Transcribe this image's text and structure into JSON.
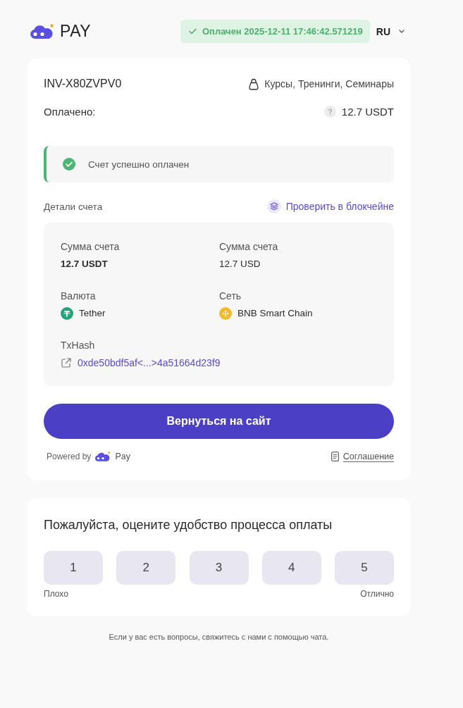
{
  "header": {
    "logo_text": "PAY",
    "status": {
      "paid": true,
      "label": "Оплачен 2025-12-11 17:46:42.571219"
    },
    "language": "RU"
  },
  "invoice": {
    "id": "INV-X80ZVPV0",
    "category": "Курсы, Тренинги, Семинары",
    "paid_label": "Оплачено:",
    "paid_amount": "12.7 USDT",
    "alert": {
      "kind": "success",
      "text": "Счет успешно оплачен"
    },
    "details_title": "Детали счета",
    "verify_link": "Проверить в блокчейне",
    "details": [
      {
        "kind": "amount",
        "label": "Сумма счета",
        "value": "12.7 USDT",
        "strong": true
      },
      {
        "kind": "amount",
        "label": "Сумма счета",
        "value": "12.7 USD",
        "strong": false
      },
      {
        "kind": "coin",
        "label": "Валюта",
        "value": "Tether",
        "color": "#26a17b"
      },
      {
        "kind": "network",
        "label": "Сеть",
        "value": "BNB Smart Chain",
        "color": "#f3ba2f"
      },
      {
        "kind": "hash",
        "label": "TxHash",
        "value": "0xde50bdf5af<...>4a51664d23f9"
      }
    ],
    "action_button": "Вернуться на сайт",
    "powered_by": "Powered by",
    "brand": "Pay",
    "agreement": "Соглашение"
  },
  "rating": {
    "title": "Пожалуйста, оцените удобство процесса оплаты",
    "options": [
      {
        "label": "1",
        "selected": false
      },
      {
        "label": "2",
        "selected": false
      },
      {
        "label": "3",
        "selected": false
      },
      {
        "label": "4",
        "selected": false
      },
      {
        "label": "5",
        "selected": false
      }
    ],
    "low_label": "Плохо",
    "high_label": "Отлично"
  },
  "help_note": "Если у вас есть вопросы, свяжитесь с нами с помощью чата."
}
